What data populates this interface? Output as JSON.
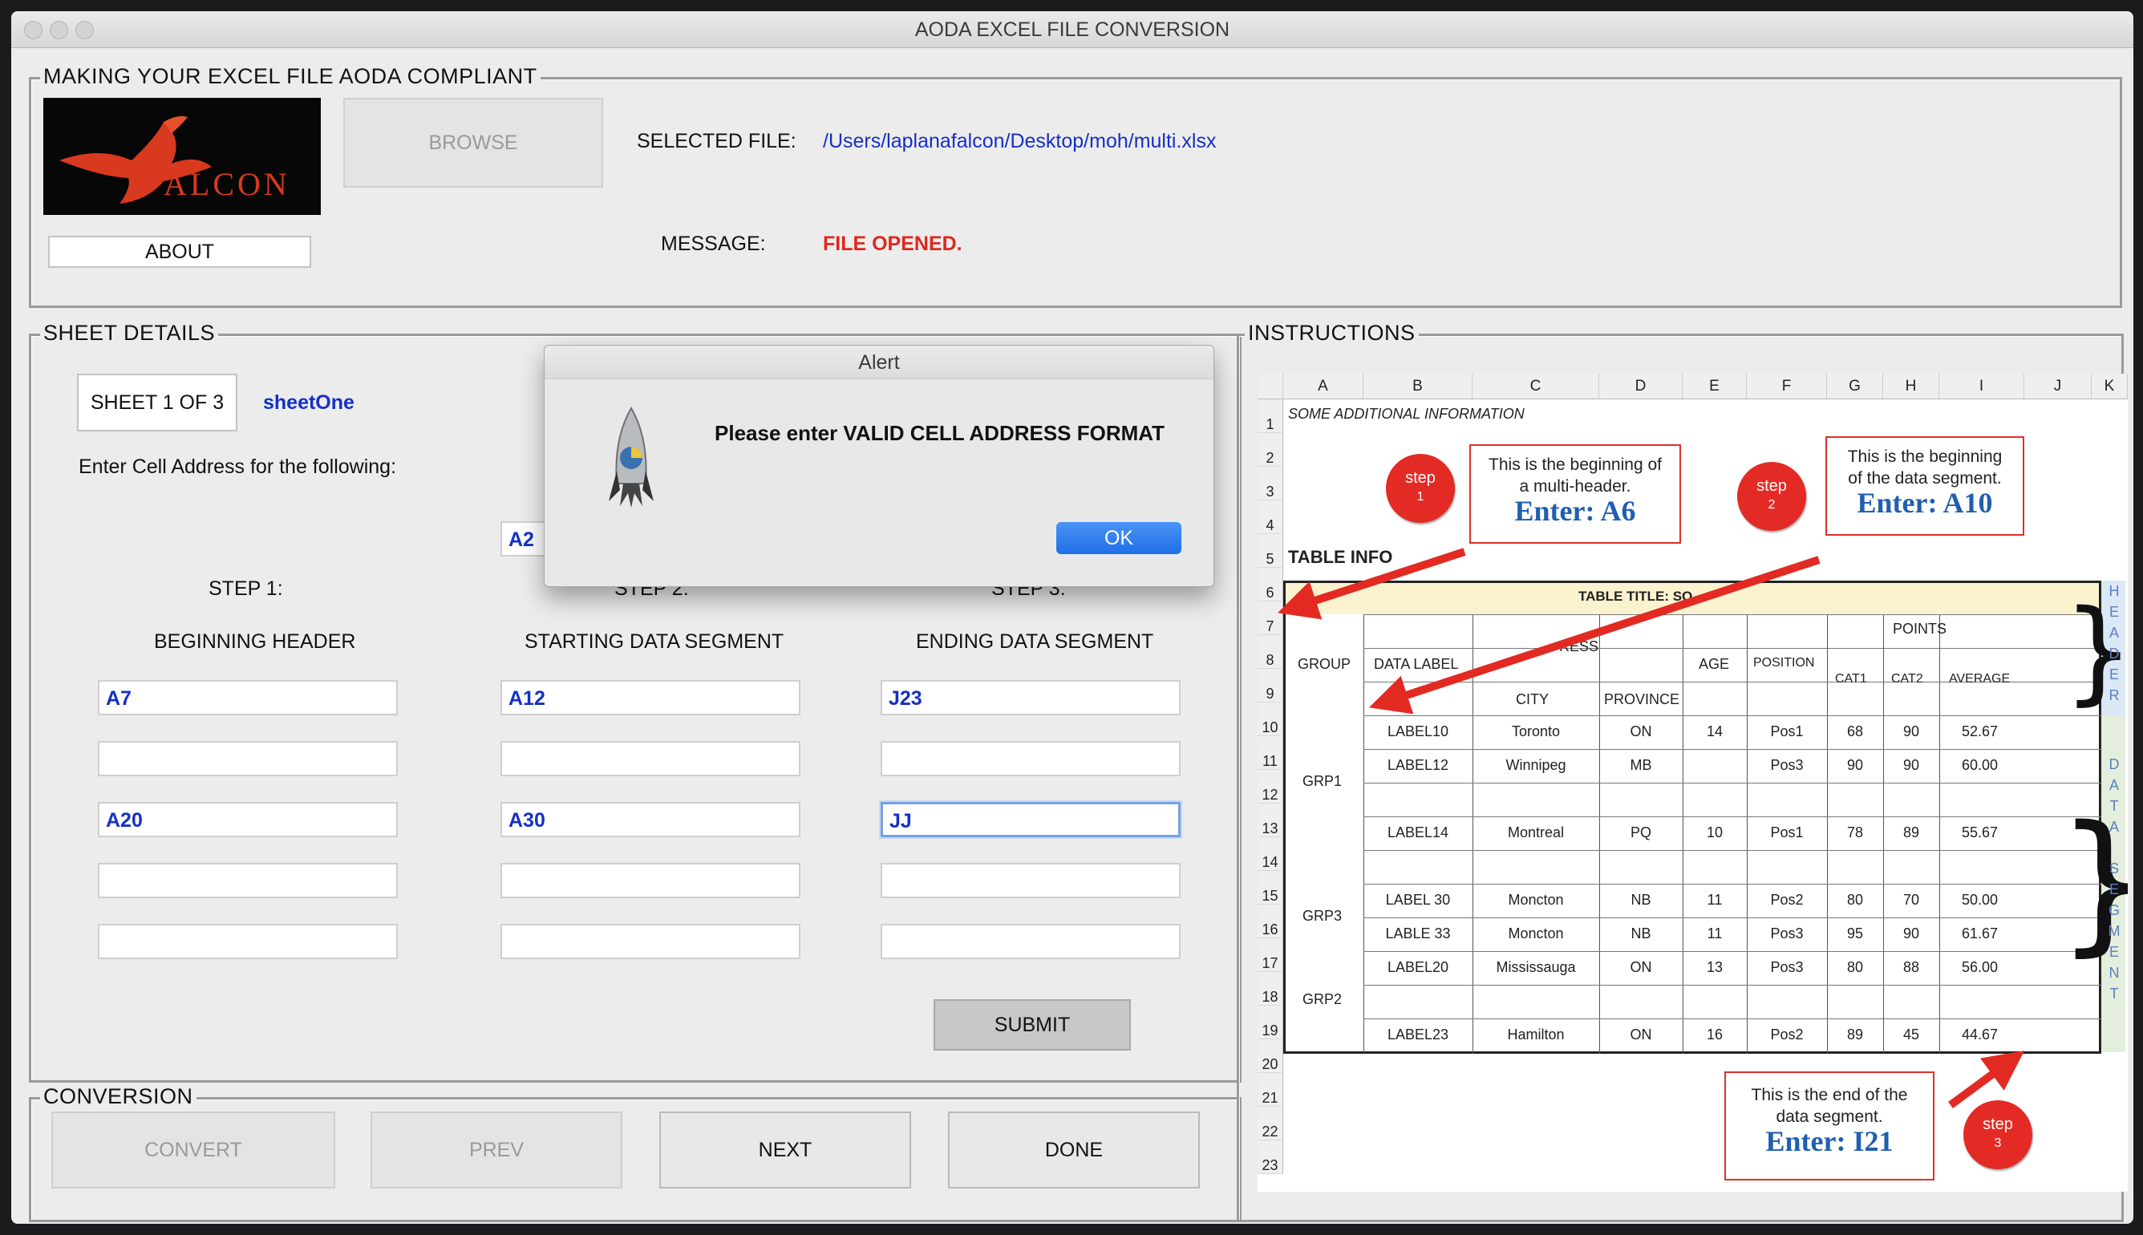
{
  "window": {
    "title": "AODA EXCEL FILE CONVERSION"
  },
  "compliance": {
    "group_label": "MAKING YOUR EXCEL FILE AODA COMPLIANT",
    "logo_text": "ALCON",
    "browse_label": "BROWSE",
    "about_label": "ABOUT",
    "selected_file_label": "SELECTED FILE:",
    "selected_file_value": "/Users/laplanafalcon/Desktop/moh/multi.xlsx",
    "message_label": "MESSAGE:",
    "message_value": "FILE OPENED."
  },
  "sheet_details": {
    "group_label": "SHEET DETAILS",
    "sheet_button": "SHEET 1 OF 3",
    "sheet_name": "sheetOne",
    "prompt": "Enter Cell Address for the following:",
    "hidden_value": "A2",
    "steps": [
      {
        "step": "STEP 1:",
        "title": "BEGINNING HEADER",
        "fields": [
          "A7",
          "",
          "A20",
          "",
          ""
        ]
      },
      {
        "step": "STEP 2:",
        "title": "STARTING DATA SEGMENT",
        "fields": [
          "A12",
          "",
          "A30",
          "",
          ""
        ]
      },
      {
        "step": "STEP 3:",
        "title": "ENDING DATA SEGMENT",
        "fields": [
          "J23",
          "",
          "JJ",
          "",
          ""
        ]
      }
    ],
    "submit_label": "SUBMIT"
  },
  "conversion": {
    "group_label": "CONVERSION",
    "convert_label": "CONVERT",
    "prev_label": "PREV",
    "next_label": "NEXT",
    "done_label": "DONE"
  },
  "alert": {
    "title": "Alert",
    "message": "Please enter VALID CELL ADDRESS FORMAT",
    "ok_label": "OK"
  },
  "instructions": {
    "group_label": "INSTRUCTIONS",
    "columns": [
      "A",
      "B",
      "C",
      "D",
      "E",
      "F",
      "G",
      "H",
      "I",
      "J",
      "K"
    ],
    "rows": [
      "1",
      "2",
      "3",
      "4",
      "5",
      "6",
      "7",
      "8",
      "9",
      "10",
      "11",
      "12",
      "13",
      "14",
      "15",
      "16",
      "17",
      "18",
      "19",
      "20",
      "21",
      "22",
      "23"
    ],
    "additional_info": "SOME ADDITIONAL INFORMATION",
    "table_info": "TABLE INFO",
    "table_title": "TABLE TITLE: SO",
    "headers": {
      "group": "GROUP",
      "data_label": "DATA LABEL",
      "address": "RESS",
      "city": "CITY",
      "province": "PROVINCE",
      "age": "AGE",
      "position": "POSITION",
      "points": "POINTS",
      "cat1": "CAT1",
      "cat2": "CAT2",
      "average": "AVERAGE"
    },
    "groups": [
      "GRP1",
      "GRP3",
      "GRP2"
    ],
    "data_rows": [
      [
        "LABEL10",
        "Toronto",
        "ON",
        "14",
        "Pos1",
        "68",
        "90",
        "52.67"
      ],
      [
        "LABEL12",
        "Winnipeg",
        "MB",
        "",
        "Pos3",
        "90",
        "90",
        "60.00"
      ],
      [
        "",
        "",
        "",
        "",
        "",
        "",
        "",
        ""
      ],
      [
        "LABEL14",
        "Montreal",
        "PQ",
        "10",
        "Pos1",
        "78",
        "89",
        "55.67"
      ],
      [
        "",
        "",
        "",
        "",
        "",
        "",
        "",
        ""
      ],
      [
        "LABEL 30",
        "Moncton",
        "NB",
        "11",
        "Pos2",
        "80",
        "70",
        "50.00"
      ],
      [
        "LABLE 33",
        "Moncton",
        "NB",
        "11",
        "Pos3",
        "95",
        "90",
        "61.67"
      ],
      [
        "LABEL20",
        "Mississauga",
        "ON",
        "13",
        "Pos3",
        "80",
        "88",
        "56.00"
      ],
      [
        "",
        "",
        "",
        "",
        "",
        "",
        "",
        ""
      ],
      [
        "LABEL23",
        "Hamilton",
        "ON",
        "16",
        "Pos2",
        "89",
        "45",
        "44.67"
      ]
    ],
    "callout1": {
      "line1": "This is the beginning of",
      "line2": "a multi-header.",
      "enter": "Enter:  A6"
    },
    "callout2": {
      "line1": "This is the beginning",
      "line2": "of the data segment.",
      "enter": "Enter:  A10"
    },
    "callout3": {
      "line1": "This is the end of the",
      "line2": "data segment.",
      "enter": "Enter:  I21"
    },
    "step_badges": [
      {
        "word": "step",
        "num": "1"
      },
      {
        "word": "step",
        "num": "2"
      },
      {
        "word": "step",
        "num": "3"
      }
    ],
    "header_vertical": "HEADER",
    "data_vertical": "DATA",
    "segment_vertical": "SEGMENT"
  }
}
